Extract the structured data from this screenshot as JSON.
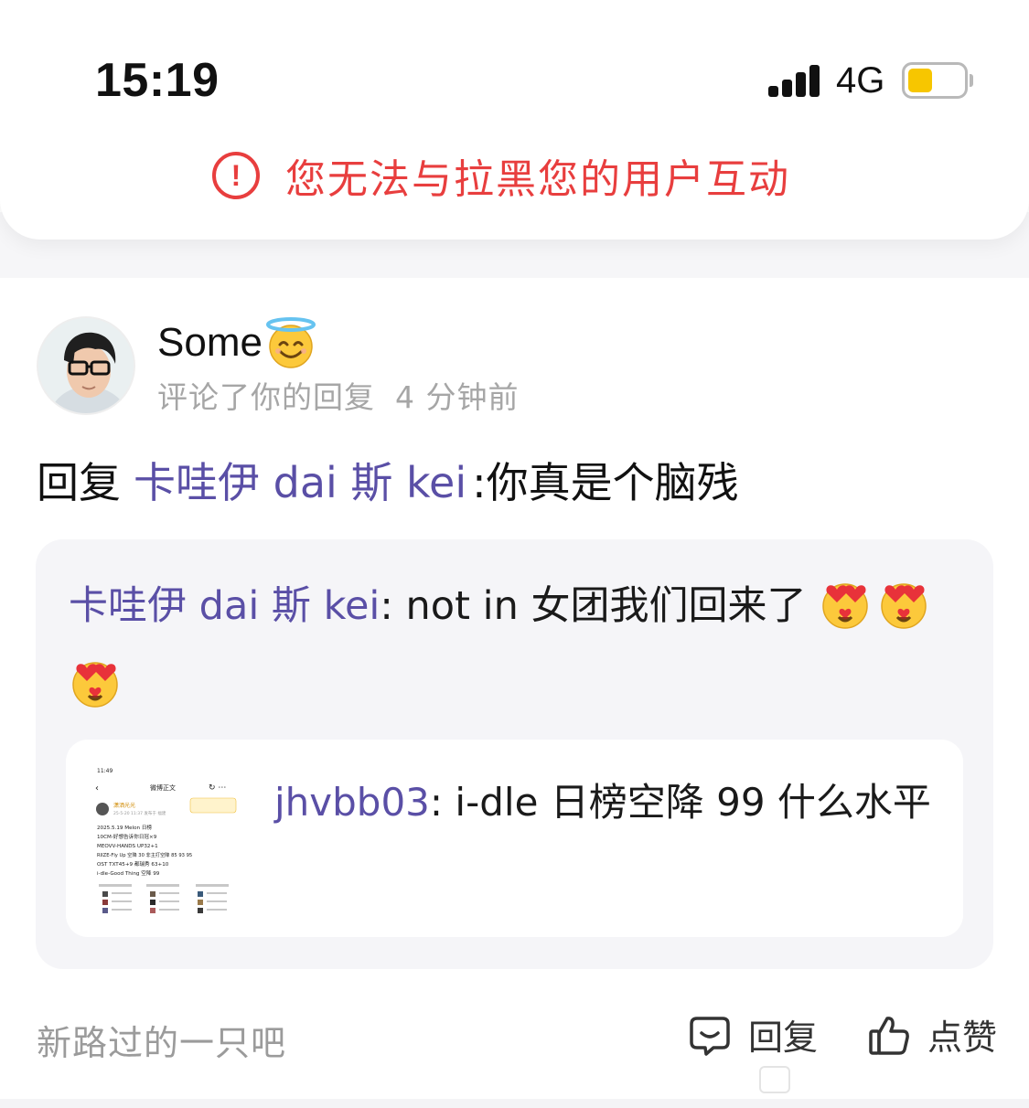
{
  "status_bar": {
    "time": "15:19",
    "network": "4G",
    "battery_level": 0.45,
    "battery_color": "#f7c600"
  },
  "notice": {
    "icon": "alert-circle-icon",
    "text": "您无法与拉黑您的用户互动",
    "color": "#e83e3e"
  },
  "comment": {
    "user_name": "Some",
    "user_emoji": "halo-smile-emoji",
    "action_text": "评论了你的回复",
    "time_ago": "4 分钟前",
    "reply_prefix": "回复",
    "reply_mention": "卡哇伊 dai 斯 kei",
    "reply_body": ":你真是个脑残"
  },
  "quoted": {
    "author": "卡哇伊 dai 斯 kei",
    "body": ": not in 女团我们回来了",
    "emoji": [
      "heart-eyes-kiss-emoji",
      "heart-eyes-kiss-emoji",
      "heart-eyes-kiss-emoji"
    ],
    "original": {
      "author": "jhvbb03",
      "body": ": i-dle 日榜空降 99 什么水平",
      "thumbnail": "screenshot-thumbnail",
      "thumbnail_lines": {
        "status": "11:49",
        "header": "微博正文",
        "poster": "潇洒光光",
        "date": "25-5-20 11:37 发布于 福建",
        "l1": "2025.5.19 Melon 日榜",
        "l2": "10CM-好想告诉你日冠×9",
        "l3": "MEOVV-HANDS UP32+1",
        "l4": "RIIZE-Fly Up 空降 30 非主打空降 85 93 95",
        "l5": "OST TXT45+9 都瑞秀 63+10",
        "l6": "i-dle-Good Thing 空降 99"
      }
    }
  },
  "footer": {
    "signature": "新路过的一只吧",
    "reply_label": "回复",
    "like_label": "点赞",
    "accent": "#5a4fa6"
  }
}
